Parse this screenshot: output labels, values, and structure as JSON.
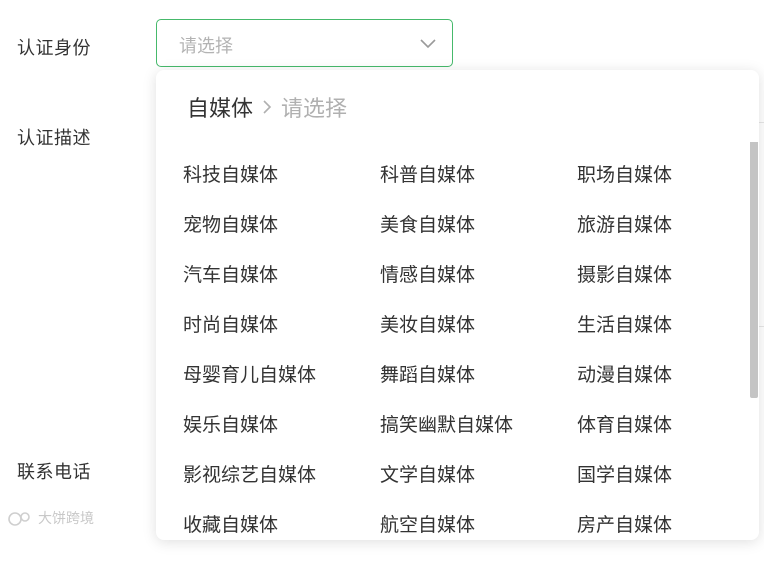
{
  "form": {
    "identity_label": "认证身份",
    "description_label": "认证描述",
    "phone_label": "联系电话",
    "identity_select": {
      "placeholder": "请选择"
    }
  },
  "dropdown": {
    "breadcrumb": {
      "first": "自媒体",
      "current": "请选择"
    },
    "options": [
      "科技自媒体",
      "科普自媒体",
      "职场自媒体",
      "宠物自媒体",
      "美食自媒体",
      "旅游自媒体",
      "汽车自媒体",
      "情感自媒体",
      "摄影自媒体",
      "时尚自媒体",
      "美妆自媒体",
      "生活自媒体",
      "母婴育儿自媒体",
      "舞蹈自媒体",
      "动漫自媒体",
      "娱乐自媒体",
      "搞笑幽默自媒体",
      "体育自媒体",
      "影视综艺自媒体",
      "文学自媒体",
      "国学自媒体",
      "收藏自媒体",
      "航空自媒体",
      "房产自媒体"
    ]
  },
  "watermark": {
    "text": "大饼跨境"
  },
  "colors": {
    "accent": "#46b96b",
    "placeholder": "#b3b3b3"
  },
  "icons": {
    "select_arrow": "chevron-down-icon",
    "breadcrumb_sep": "chevron-right-icon"
  }
}
